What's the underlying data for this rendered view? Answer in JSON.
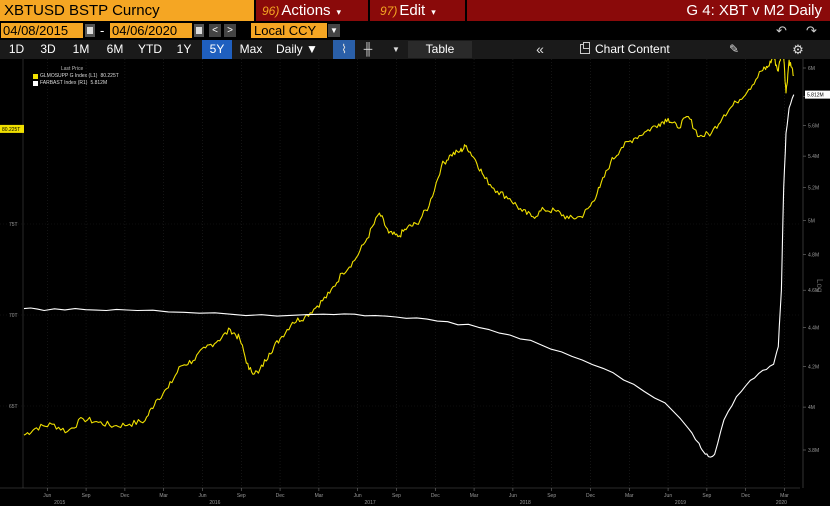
{
  "header": {
    "security": "XBTUSD BSTP Curncy",
    "actions_num": "96)",
    "actions_label": "Actions",
    "edit_num": "97)",
    "edit_label": "Edit",
    "window_title": "G 4: XBT v M2 Daily"
  },
  "toolbar": {
    "start_date": "04/08/2015",
    "end_date": "04/06/2020",
    "date_separator": "-",
    "currency": "Local CCY",
    "periods": [
      "1D",
      "3D",
      "1M",
      "6M",
      "YTD",
      "1Y",
      "5Y",
      "Max"
    ],
    "active_period": "5Y",
    "frequency": "Daily",
    "table_label": "Table",
    "chart_content_label": "Chart Content"
  },
  "legend": {
    "header": "Last Price",
    "items": [
      {
        "name": "GLMOSUPP G Index (L1)",
        "value": "80.225T",
        "color": "#f0e000"
      },
      {
        "name": "FARBAST Index (R1)",
        "value": "5.812M",
        "color": "#ffffff"
      }
    ]
  },
  "chart_data": {
    "type": "line",
    "left_axis": {
      "ticks": [
        "80.225T",
        "75T",
        "70T",
        "65T"
      ],
      "values": [
        80.225,
        75,
        70,
        65
      ],
      "last_value_label": "80.225T"
    },
    "right_axis": {
      "ticks": [
        "6M",
        "5.8M",
        "5.6M",
        "5.4M",
        "5.2M",
        "5M",
        "4.8M",
        "4.6M",
        "4.4M",
        "4.2M",
        "4M",
        "3.8M"
      ],
      "values": [
        6.0,
        5.8,
        5.6,
        5.4,
        5.2,
        5.0,
        4.8,
        4.6,
        4.4,
        4.2,
        4.0,
        3.8
      ],
      "scale": "log",
      "scale_label": "Log",
      "last_value_label": "5.812M"
    },
    "x_axis": {
      "months": [
        "Jun",
        "Sep",
        "Dec",
        "Mar",
        "Jun",
        "Sep",
        "Dec",
        "Mar",
        "Jun",
        "Sep",
        "Dec",
        "Mar",
        "Jun",
        "Sep",
        "Dec",
        "Mar",
        "Jun",
        "Sep",
        "Dec",
        "Mar"
      ],
      "month_dates": [
        2015.42,
        2015.67,
        2015.92,
        2016.17,
        2016.42,
        2016.67,
        2016.92,
        2017.17,
        2017.42,
        2017.67,
        2017.92,
        2018.17,
        2018.42,
        2018.67,
        2018.92,
        2019.17,
        2019.42,
        2019.67,
        2019.92,
        2020.17
      ],
      "years": [
        "2015",
        "2016",
        "2017",
        "2018",
        "2019",
        "2020"
      ],
      "year_dates": [
        2015.5,
        2016.5,
        2017.5,
        2018.5,
        2019.5,
        2020.15
      ],
      "range": [
        2015.27,
        2020.27
      ]
    },
    "series": [
      {
        "name": "GLMOSUPP G Index (L1)",
        "axis": "left",
        "color": "#f0e000",
        "x": [
          2015.27,
          2015.35,
          2015.45,
          2015.55,
          2015.65,
          2015.75,
          2015.85,
          2015.95,
          2016.05,
          2016.12,
          2016.2,
          2016.28,
          2016.36,
          2016.44,
          2016.52,
          2016.6,
          2016.66,
          2016.72,
          2016.78,
          2016.85,
          2016.92,
          2017.0,
          2017.08,
          2017.16,
          2017.24,
          2017.32,
          2017.4,
          2017.48,
          2017.56,
          2017.62,
          2017.68,
          2017.74,
          2017.8,
          2017.88,
          2017.96,
          2018.02,
          2018.08,
          2018.12,
          2018.18,
          2018.24,
          2018.32,
          2018.4,
          2018.48,
          2018.55,
          2018.62,
          2018.7,
          2018.78,
          2018.86,
          2018.92,
          2018.98,
          2019.05,
          2019.12,
          2019.2,
          2019.28,
          2019.36,
          2019.42,
          2019.48,
          2019.55,
          2019.62,
          2019.7,
          2019.78,
          2019.86,
          2019.94,
          2020.02,
          2020.06,
          2020.1,
          2020.13,
          2020.16,
          2020.18,
          2020.2,
          2020.23
        ],
        "y": [
          63.4,
          63.8,
          64.0,
          63.6,
          64.3,
          64.1,
          63.9,
          64.0,
          64.2,
          65.3,
          66.0,
          67.2,
          67.5,
          68.2,
          68.6,
          69.2,
          68.7,
          67.0,
          66.8,
          67.9,
          68.7,
          69.6,
          69.9,
          70.5,
          71.2,
          72.3,
          73.0,
          74.2,
          75.6,
          74.5,
          74.3,
          74.8,
          75.0,
          76.0,
          78.2,
          78.8,
          79.0,
          79.3,
          78.5,
          77.5,
          76.8,
          76.4,
          75.7,
          75.4,
          75.8,
          75.7,
          75.3,
          75.4,
          76.0,
          77.0,
          78.4,
          79.2,
          79.7,
          80.1,
          80.5,
          80.8,
          80.3,
          80.9,
          79.8,
          80.0,
          81.0,
          81.7,
          82.4,
          83.4,
          83.6,
          84.2,
          83.4,
          85.0,
          82.2,
          84.0,
          83.2
        ]
      },
      {
        "name": "FARBAST Index (R1)",
        "axis": "right",
        "color": "#ffffff",
        "x": [
          2015.27,
          2015.4,
          2015.6,
          2015.8,
          2016.0,
          2016.3,
          2016.6,
          2016.9,
          2017.2,
          2017.4,
          2017.6,
          2017.8,
          2018.0,
          2018.2,
          2018.4,
          2018.6,
          2018.8,
          2019.0,
          2019.2,
          2019.4,
          2019.55,
          2019.62,
          2019.65,
          2019.68,
          2019.72,
          2019.78,
          2019.86,
          2019.95,
          2020.03,
          2020.1,
          2020.13,
          2020.15,
          2020.165,
          2020.18,
          2020.2,
          2020.23
        ],
        "y": [
          4.5,
          4.49,
          4.5,
          4.49,
          4.49,
          4.48,
          4.47,
          4.46,
          4.47,
          4.47,
          4.46,
          4.45,
          4.43,
          4.4,
          4.36,
          4.31,
          4.25,
          4.19,
          4.11,
          4.02,
          3.9,
          3.83,
          3.79,
          3.77,
          3.78,
          3.94,
          4.05,
          4.13,
          4.18,
          4.21,
          4.3,
          4.6,
          5.2,
          5.55,
          5.72,
          5.812
        ]
      }
    ]
  }
}
